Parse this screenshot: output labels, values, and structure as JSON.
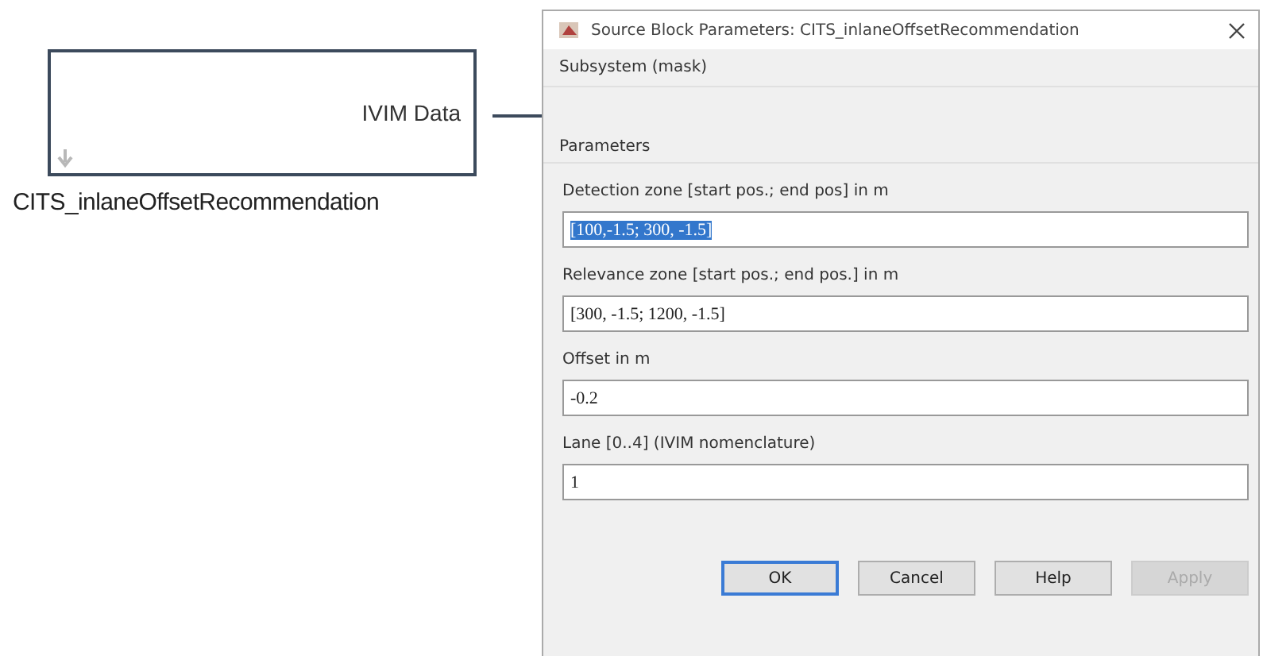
{
  "block": {
    "port_label": "IVIM Data",
    "name": "CITS_inlaneOffsetRecommendation"
  },
  "dialog": {
    "title": "Source Block Parameters: CITS_inlaneOffsetRecommendation",
    "description": "Subsystem (mask)",
    "section": "Parameters",
    "fields": [
      {
        "label": "Detection zone [start pos.; end pos] in m",
        "value": "[100,-1.5; 300, -1.5]",
        "selected": true
      },
      {
        "label": "Relevance zone [start pos.; end pos.] in m",
        "value": "[300, -1.5; 1200, -1.5]",
        "selected": false
      },
      {
        "label": "Offset in m",
        "value": "-0.2",
        "selected": false
      },
      {
        "label": "Lane [0..4] (IVIM nomenclature)",
        "value": "1",
        "selected": false
      }
    ],
    "buttons": [
      {
        "label": "OK",
        "default": true,
        "disabled": false
      },
      {
        "label": "Cancel",
        "default": false,
        "disabled": false
      },
      {
        "label": "Help",
        "default": false,
        "disabled": false
      },
      {
        "label": "Apply",
        "default": false,
        "disabled": true
      }
    ]
  }
}
